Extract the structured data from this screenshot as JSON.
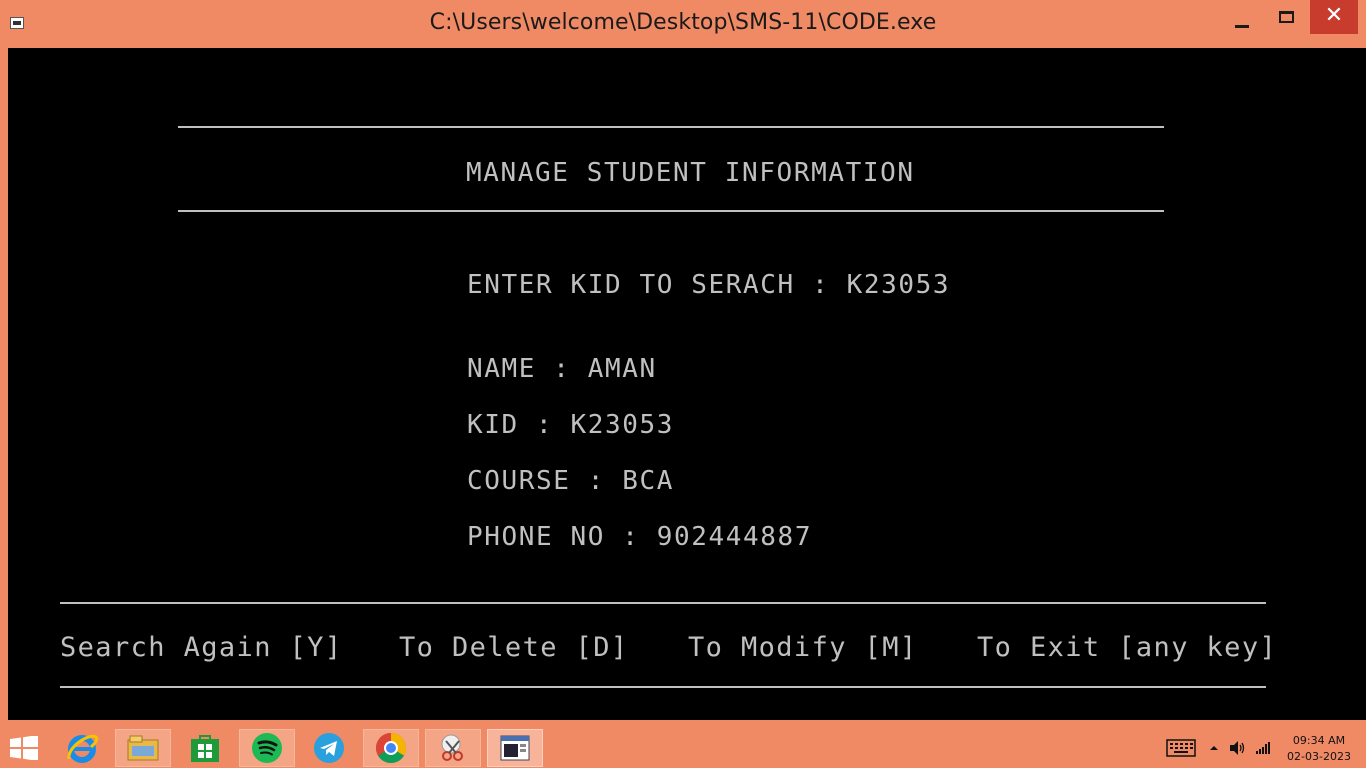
{
  "window": {
    "title": "C:\\Users\\welcome\\Desktop\\SMS-11\\CODE.exe",
    "controls": {
      "minimize": "—",
      "maximize": "□",
      "close": "✕"
    }
  },
  "console": {
    "heading": "MANAGE STUDENT INFORMATION",
    "search_prompt": "ENTER KID TO SERACH : K23053",
    "fields": {
      "name": "NAME : AMAN",
      "kid": "KID : K23053",
      "course": "COURSE : BCA",
      "phone": "PHONE NO : 902444887"
    },
    "menu": {
      "search_again": "Search Again [Y]",
      "delete": "To Delete [D]",
      "modify": "To Modify [M]",
      "exit": "To Exit [any key]"
    }
  },
  "taskbar": {
    "apps": [
      "internet-explorer-icon",
      "file-explorer-icon",
      "store-icon",
      "spotify-icon",
      "telegram-icon",
      "chrome-icon",
      "snipping-tool-icon",
      "console-app-icon"
    ],
    "clock": {
      "time": "09:34 AM",
      "date": "02-03-2023"
    },
    "colors": {
      "accent": "#f08a64",
      "close": "#c73c2d"
    }
  }
}
